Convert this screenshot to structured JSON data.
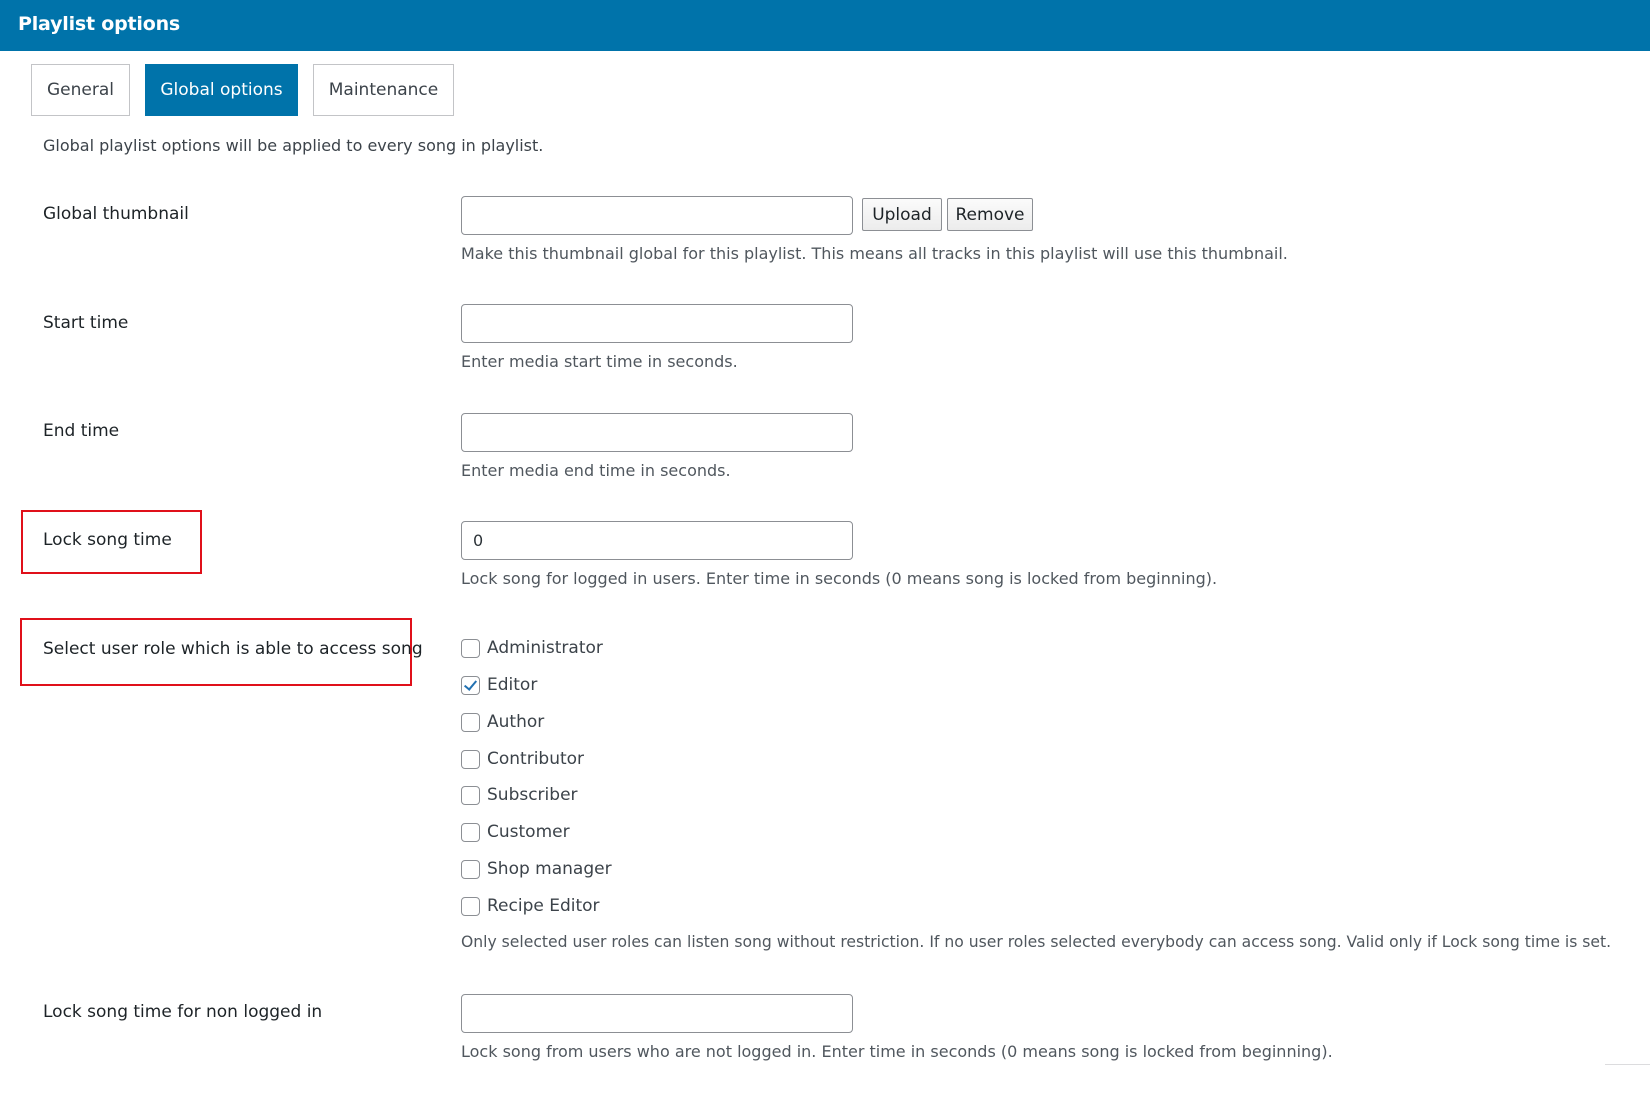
{
  "header": {
    "title": "Playlist options"
  },
  "tabs": [
    {
      "label": "General",
      "active": false
    },
    {
      "label": "Global options",
      "active": true
    },
    {
      "label": "Maintenance",
      "active": false
    }
  ],
  "intro": "Global playlist options will be applied to every song in playlist.",
  "fields": {
    "thumbnail": {
      "label": "Global thumbnail",
      "value": "",
      "upload_label": "Upload",
      "remove_label": "Remove",
      "help": "Make this thumbnail global for this playlist. This means all tracks in this playlist will use this thumbnail."
    },
    "start_time": {
      "label": "Start time",
      "value": "",
      "help": "Enter media start time in seconds."
    },
    "end_time": {
      "label": "End time",
      "value": "",
      "help": "Enter media end time in seconds."
    },
    "lock_time": {
      "label": "Lock song time",
      "value": "0",
      "help": "Lock song for logged in users. Enter time in seconds (0 means song is locked from beginning)."
    },
    "user_roles": {
      "label": "Select user role which is able to access song",
      "options": [
        {
          "label": "Administrator",
          "checked": false
        },
        {
          "label": "Editor",
          "checked": true
        },
        {
          "label": "Author",
          "checked": false
        },
        {
          "label": "Contributor",
          "checked": false
        },
        {
          "label": "Subscriber",
          "checked": false
        },
        {
          "label": "Customer",
          "checked": false
        },
        {
          "label": "Shop manager",
          "checked": false
        },
        {
          "label": "Recipe Editor",
          "checked": false
        }
      ],
      "help": "Only selected user roles can listen song without restriction. If no user roles selected everybody can access song. Valid only if Lock song time is set."
    },
    "lock_non_logged": {
      "label": "Lock song time for non logged in",
      "value": "",
      "help": "Lock song from users who are not logged in. Enter time in seconds (0 means song is locked from beginning)."
    }
  },
  "colors": {
    "header_bg": "#0073aa",
    "active_tab": "#0073aa",
    "highlight": "#e0101a",
    "check": "#2271b1"
  }
}
